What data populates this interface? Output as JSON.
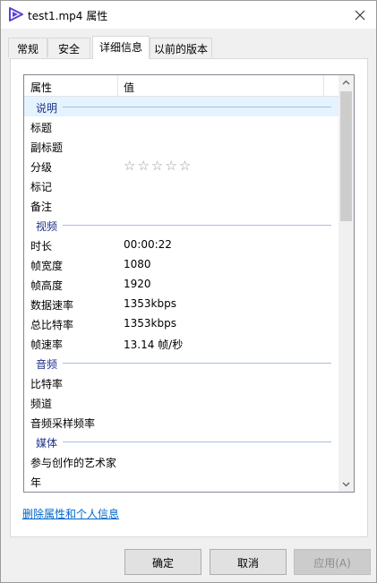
{
  "window": {
    "title": "test1.mp4 属性"
  },
  "tabs": [
    "常规",
    "安全",
    "详细信息",
    "以前的版本"
  ],
  "columns": {
    "property": "属性",
    "value": "值"
  },
  "rows": [
    {
      "type": "group",
      "label": "说明",
      "selected": true
    },
    {
      "type": "item",
      "key": "标题",
      "value": ""
    },
    {
      "type": "item",
      "key": "副标题",
      "value": ""
    },
    {
      "type": "rating",
      "key": "分级",
      "value": "☆☆☆☆☆",
      "rating": 0
    },
    {
      "type": "item",
      "key": "标记",
      "value": ""
    },
    {
      "type": "item",
      "key": "备注",
      "value": ""
    },
    {
      "type": "group",
      "label": "视频"
    },
    {
      "type": "item",
      "key": "时长",
      "value": "00:00:22"
    },
    {
      "type": "item",
      "key": "帧宽度",
      "value": "1080"
    },
    {
      "type": "item",
      "key": "帧高度",
      "value": "1920"
    },
    {
      "type": "item",
      "key": "数据速率",
      "value": "1353kbps"
    },
    {
      "type": "item",
      "key": "总比特率",
      "value": "1353kbps"
    },
    {
      "type": "item",
      "key": "帧速率",
      "value": "13.14 帧/秒"
    },
    {
      "type": "group",
      "label": "音频"
    },
    {
      "type": "item",
      "key": "比特率",
      "value": ""
    },
    {
      "type": "item",
      "key": "频道",
      "value": ""
    },
    {
      "type": "item",
      "key": "音频采样频率",
      "value": ""
    },
    {
      "type": "group",
      "label": "媒体"
    },
    {
      "type": "item",
      "key": "参与创作的艺术家",
      "value": ""
    },
    {
      "type": "item",
      "key": "年",
      "value": ""
    }
  ],
  "remove_link": "删除属性和个人信息",
  "buttons": {
    "ok": "确定",
    "cancel": "取消",
    "apply": "应用(A)"
  },
  "colors": {
    "accent": "#0066cc",
    "group_text": "#1e3287",
    "selection": "#e5f3ff",
    "app_icon": "#5b3fd6"
  }
}
